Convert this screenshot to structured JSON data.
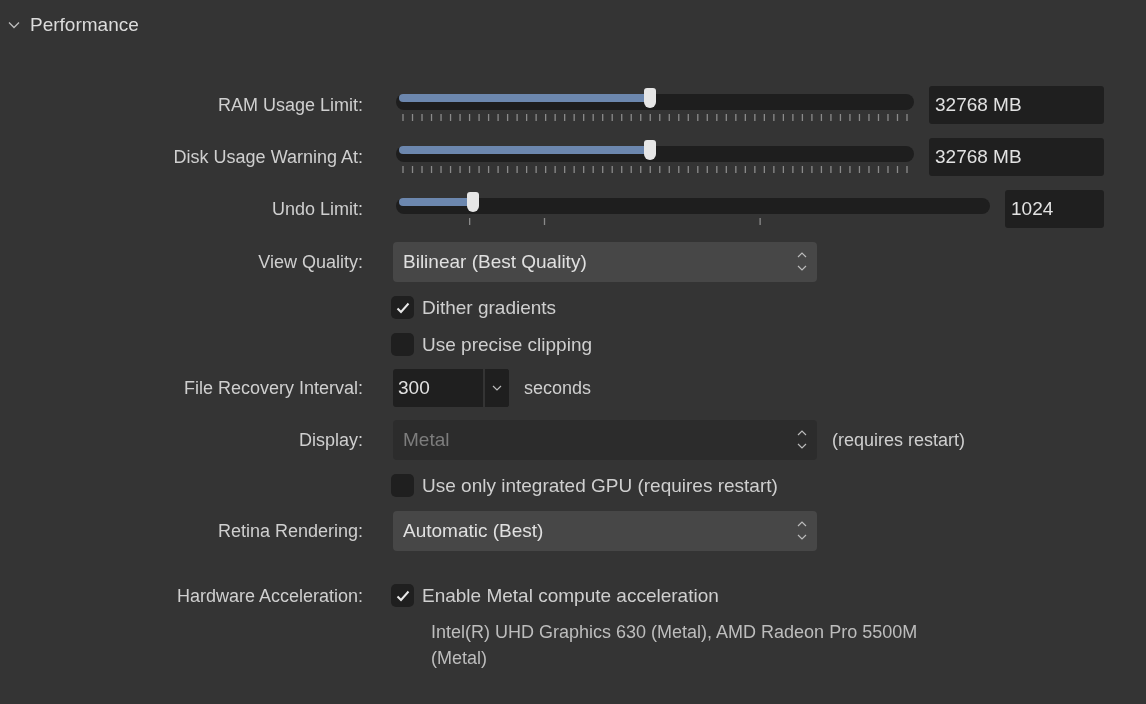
{
  "section": {
    "title": "Performance",
    "expanded": true
  },
  "rows": [
    {
      "kind": "fineslider",
      "label": "RAM Usage Limit:",
      "level": 0.49,
      "value": "32768 MB"
    },
    {
      "kind": "fineslider",
      "label": "Disk Usage Warning At:",
      "level": 0.49,
      "value": "32768 MB"
    },
    {
      "kind": "coarseslider",
      "label": "Undo Limit:",
      "level": 0.13,
      "value": "1024"
    },
    {
      "kind": "select",
      "label": "View Quality:",
      "value": "Bilinear (Best Quality)",
      "disabled": false
    },
    {
      "kind": "checkbox",
      "text": "Dither gradients",
      "checked": true
    },
    {
      "kind": "checkbox",
      "text": "Use precise clipping",
      "checked": false
    },
    {
      "kind": "combo",
      "label": "File Recovery Interval:",
      "value": "300",
      "unit": "seconds"
    },
    {
      "kind": "select",
      "label": "Display:",
      "value": "Metal",
      "disabled": true,
      "note": "(requires restart)"
    },
    {
      "kind": "checkbox",
      "text": "Use only integrated GPU (requires restart)",
      "checked": false
    },
    {
      "kind": "select",
      "label": "Retina Rendering:",
      "value": "Automatic (Best)",
      "disabled": false
    },
    {
      "kind": "checkbox",
      "label": "Hardware Acceleration:",
      "text": "Enable Metal compute acceleration",
      "checked": true
    },
    {
      "kind": "info",
      "text": "Intel(R) UHD Graphics 630 (Metal), AMD Radeon Pro 5500M (Metal)"
    }
  ]
}
